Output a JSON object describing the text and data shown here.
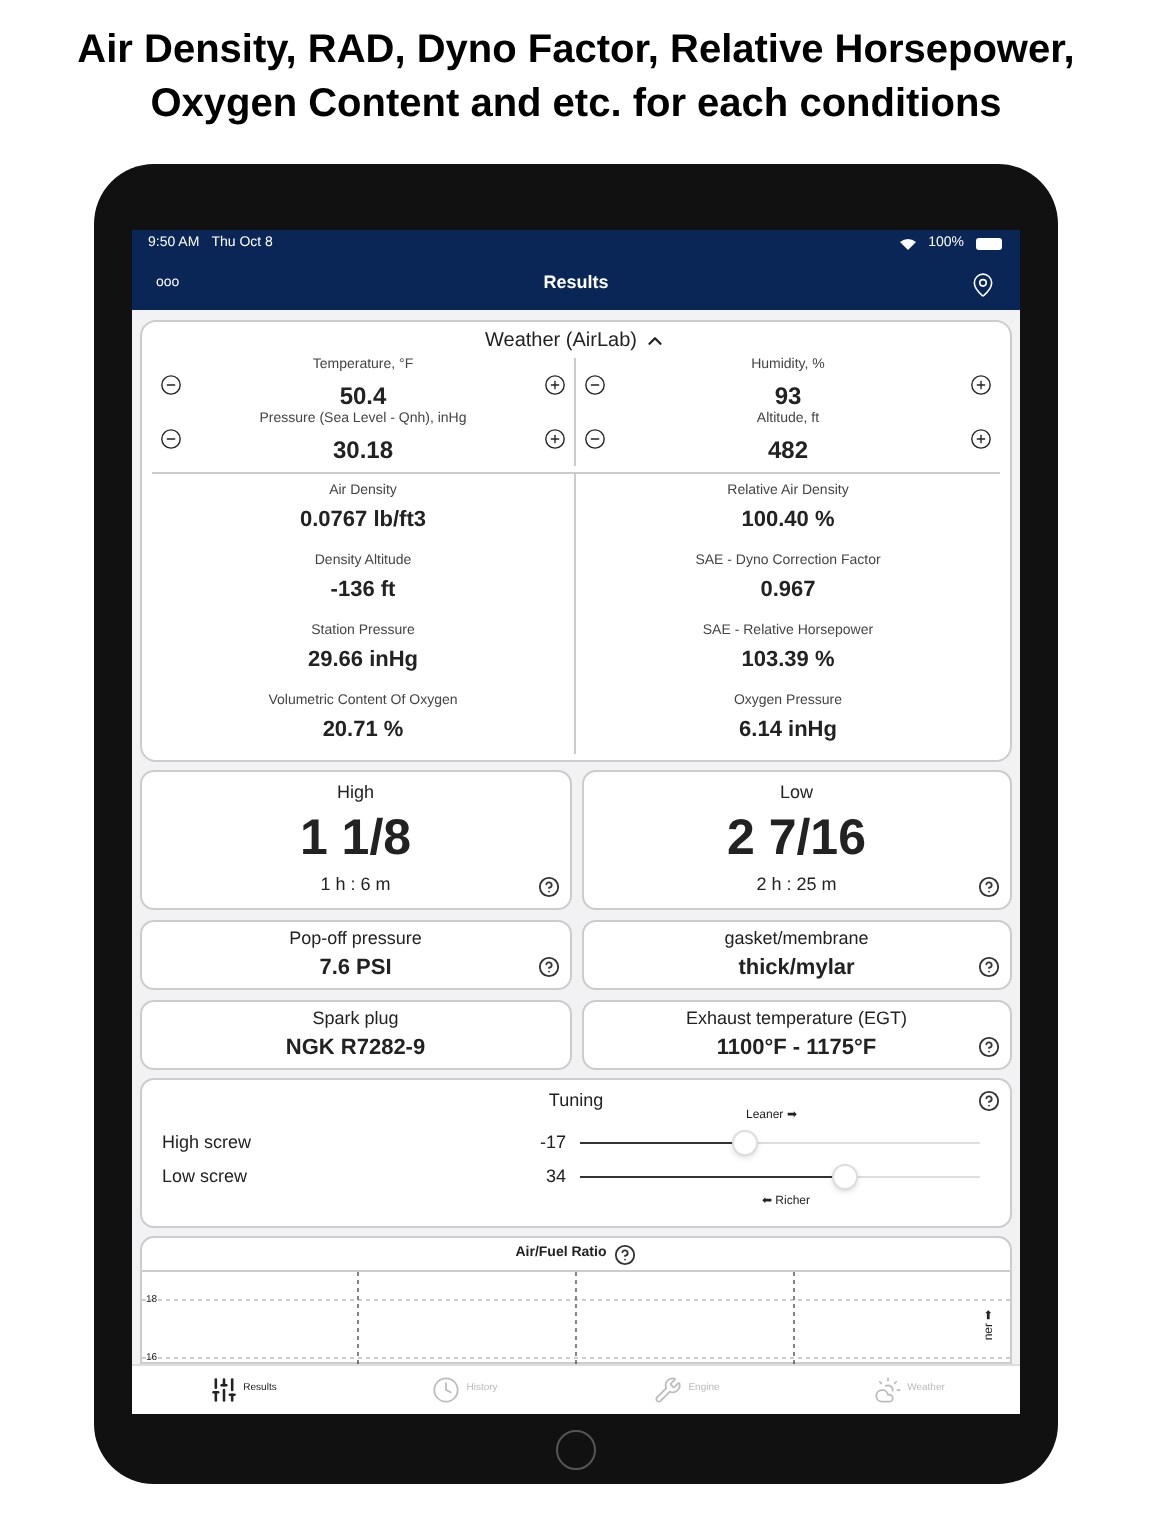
{
  "headline": "Air Density, RAD, Dyno Factor, Relative Horsepower, Oxygen Content and etc. for each conditions",
  "status_bar": {
    "time": "9:50 AM",
    "date": "Thu Oct 8",
    "battery": "100%"
  },
  "nav": {
    "menu": "ooo",
    "title": "Results"
  },
  "weather": {
    "title": "Weather (AirLab)",
    "expanded": true,
    "inputs": [
      {
        "label": "Temperature, °F",
        "value": "50.4"
      },
      {
        "label": "Humidity, %",
        "value": "93"
      },
      {
        "label": "Pressure (Sea Level - Qnh), inHg",
        "value": "30.18"
      },
      {
        "label": "Altitude, ft",
        "value": "482"
      }
    ],
    "results": [
      {
        "label": "Air Density",
        "value": "0.0767 lb/ft3"
      },
      {
        "label": "Relative Air Density",
        "value": "100.40 %"
      },
      {
        "label": "Density Altitude",
        "value": "-136 ft"
      },
      {
        "label": "SAE - Dyno Correction Factor",
        "value": "0.967"
      },
      {
        "label": "Station Pressure",
        "value": "29.66 inHg"
      },
      {
        "label": "SAE - Relative Horsepower",
        "value": "103.39 %"
      },
      {
        "label": "Volumetric Content Of Oxygen",
        "value": "20.71 %"
      },
      {
        "label": "Oxygen Pressure",
        "value": "6.14 inHg"
      }
    ]
  },
  "jets": [
    {
      "label": "High",
      "value": "1 1/8",
      "time": "1 h : 6 m"
    },
    {
      "label": "Low",
      "value": "2 7/16",
      "time": "2 h : 25 m"
    }
  ],
  "specs": [
    {
      "label": "Pop-off pressure",
      "value": "7.6 PSI",
      "help": true
    },
    {
      "label": "gasket/membrane",
      "value": "thick/mylar",
      "help": true
    },
    {
      "label": "Spark plug",
      "value": "NGK R7282-9",
      "help": false
    },
    {
      "label": "Exhaust temperature (EGT)",
      "value": "1100°F - 1175°F",
      "help": true
    }
  ],
  "tuning": {
    "title": "Tuning",
    "leaner": "Leaner ➡",
    "richer": "⬅ Richer",
    "screws": [
      {
        "label": "High screw",
        "reading": "-17",
        "level": 0.41
      },
      {
        "label": "Low screw",
        "reading": "34",
        "level": 0.66
      }
    ]
  },
  "afr": {
    "title": "Air/Fuel Ratio",
    "y_ticks": [
      "18",
      "16"
    ],
    "edge_text": "ner ➡"
  },
  "tabs": [
    {
      "kind": "results",
      "label": "Results",
      "selected": true
    },
    {
      "kind": "history",
      "label": "History",
      "selected": false
    },
    {
      "kind": "engine",
      "label": "Engine",
      "selected": false
    },
    {
      "kind": "weather",
      "label": "Weather",
      "selected": false
    }
  ]
}
